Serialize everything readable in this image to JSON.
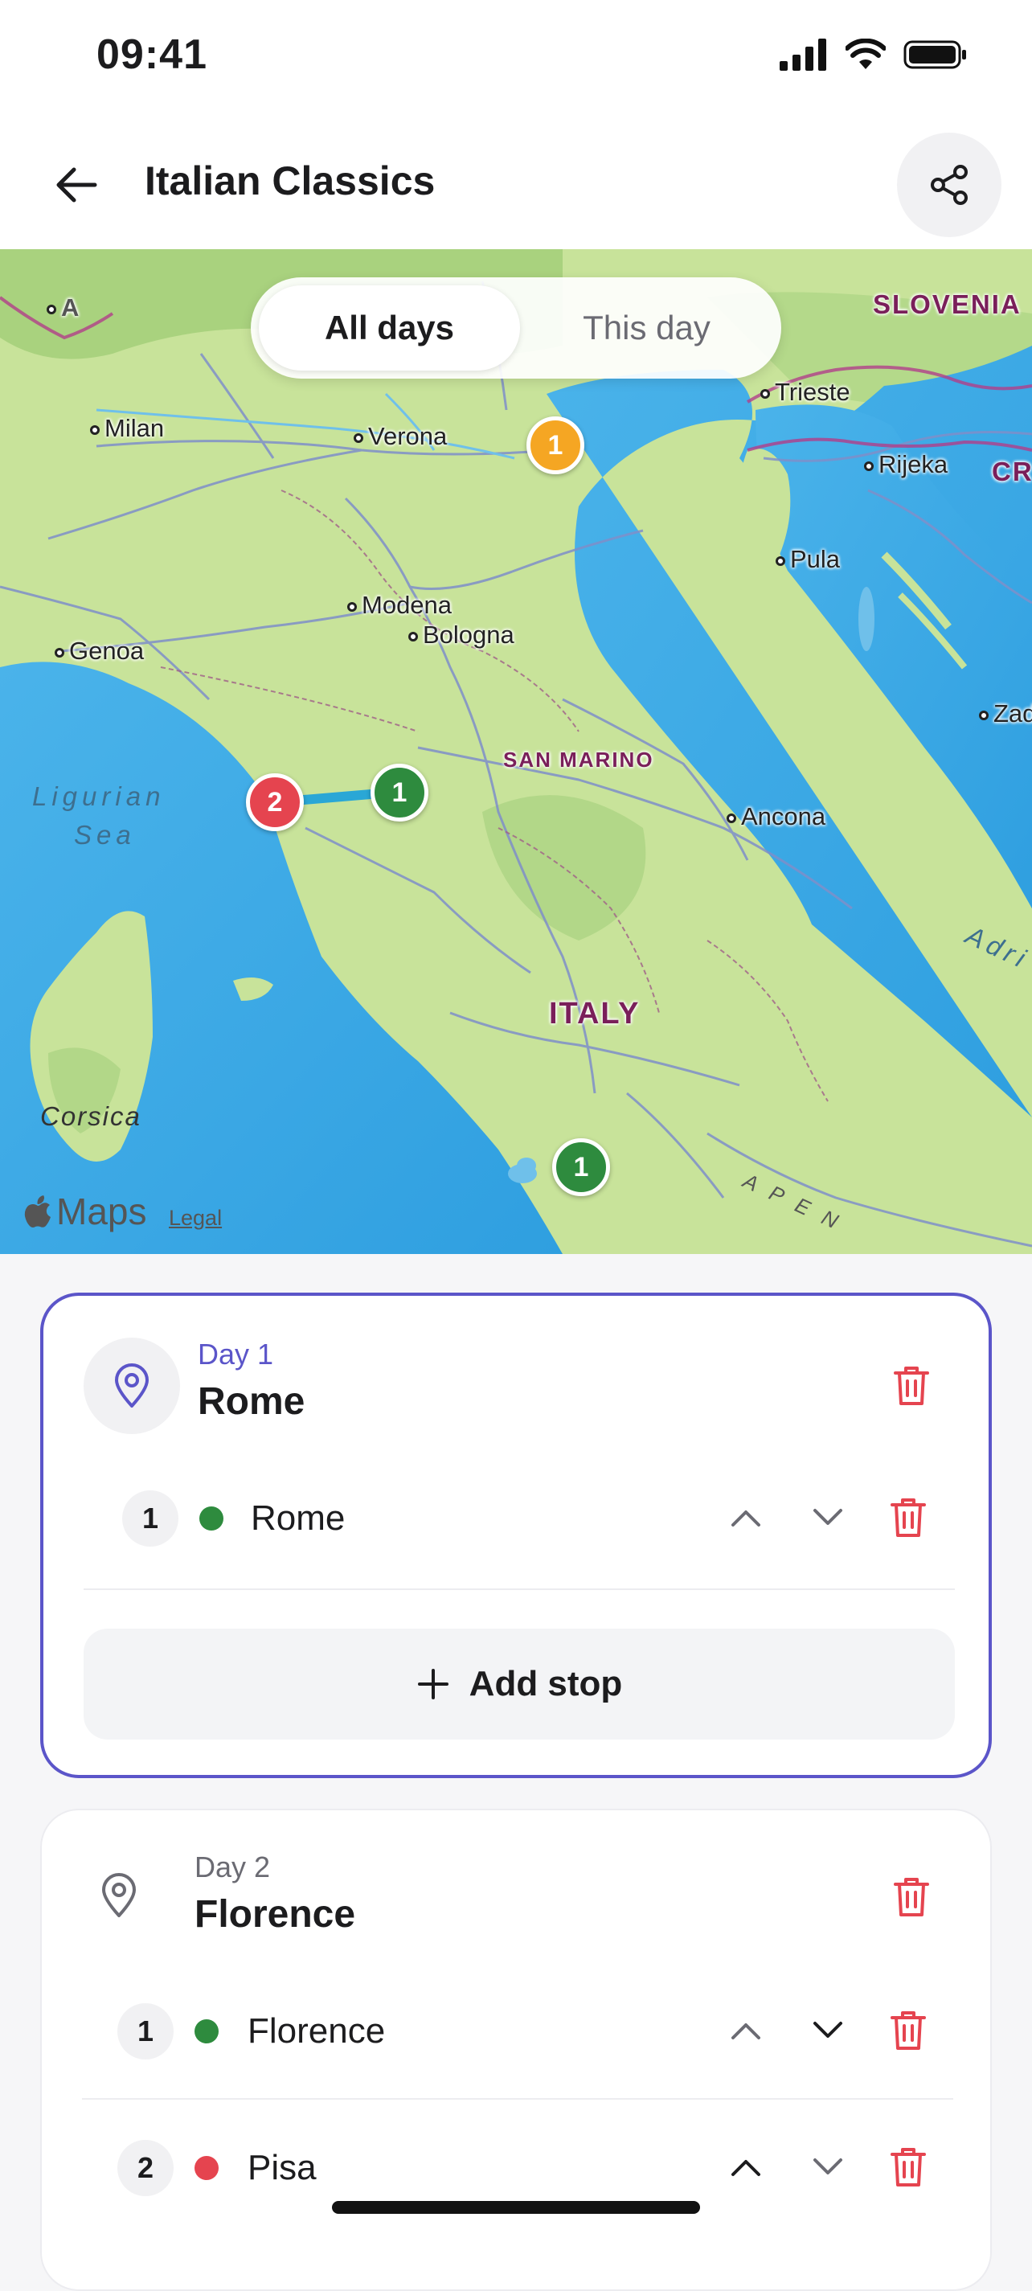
{
  "status_bar": {
    "time": "09:41"
  },
  "header": {
    "title": "Italian Classics"
  },
  "map": {
    "segmented": {
      "all_days": "All days",
      "this_day": "This day"
    },
    "labels": {
      "slovenia": "SLOVENIA",
      "cro": "CR",
      "milan": "Milan",
      "verona": "Verona",
      "trieste": "Trieste",
      "rijeka": "Rijeka",
      "pula": "Pula",
      "modena": "Modena",
      "bologna": "Bologna",
      "genoa": "Genoa",
      "zadar": "Zad",
      "ligurian_1": "Ligurian",
      "ligurian_2": "Sea",
      "san_marino": "SAN MARINO",
      "ancona": "Ancona",
      "italy": "ITALY",
      "adriatic": "Adri",
      "corsica": "Corsica",
      "apennines": "A P E N",
      "a_corner": "A"
    },
    "pins": [
      {
        "label": "1",
        "color": "#f5a623"
      },
      {
        "label": "2",
        "color": "#e5444f"
      },
      {
        "label": "1",
        "color": "#2e8b3e"
      },
      {
        "label": "1",
        "color": "#2e8b3e"
      }
    ],
    "attribution": {
      "maps": "Maps",
      "legal": "Legal"
    }
  },
  "days": [
    {
      "day_label": "Day 1",
      "city": "Rome",
      "accent": "#5b55c9",
      "stops": [
        {
          "num": "1",
          "name": "Rome",
          "dot_color": "#2e8b3e"
        }
      ],
      "add_stop_label": "Add stop"
    },
    {
      "day_label": "Day 2",
      "city": "Florence",
      "stops": [
        {
          "num": "1",
          "name": "Florence",
          "dot_color": "#2e8b3e"
        },
        {
          "num": "2",
          "name": "Pisa",
          "dot_color": "#e5444f"
        }
      ]
    }
  ],
  "colors": {
    "delete": "#e5444f",
    "accent": "#5b55c9"
  },
  "icons": [
    "back-arrow-icon",
    "share-icon",
    "map-pin-icon",
    "trash-icon",
    "chevron-up-icon",
    "chevron-down-icon",
    "plus-icon",
    "apple-logo-icon"
  ]
}
